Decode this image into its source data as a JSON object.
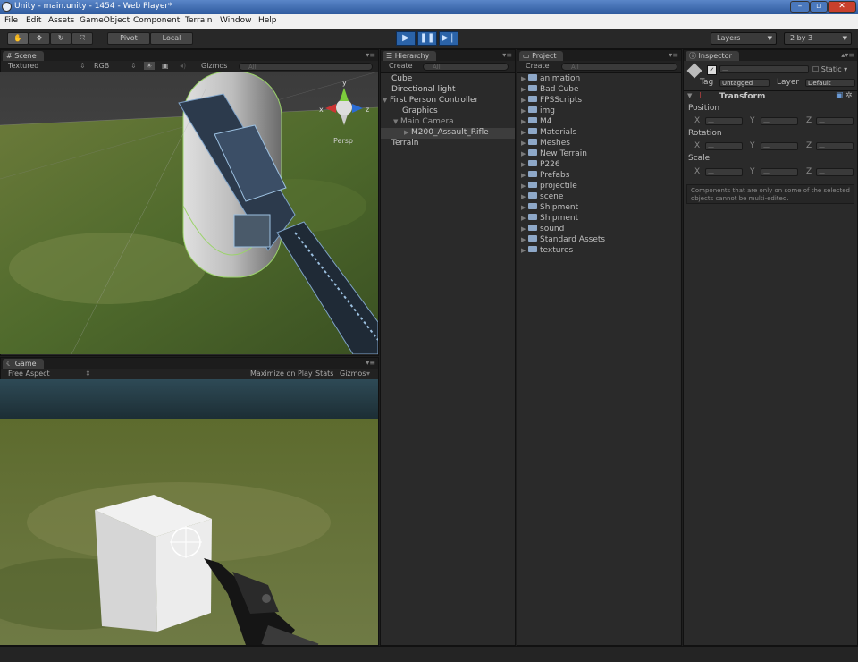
{
  "window": {
    "title": "Unity - main.unity - 1454 - Web Player*"
  },
  "menu": [
    "File",
    "Edit",
    "Assets",
    "GameObject",
    "Component",
    "Terrain",
    "Window",
    "Help"
  ],
  "toolbar": {
    "pivot": "Pivot",
    "local": "Local",
    "layers": "Layers",
    "layout": "2 by 3"
  },
  "scene": {
    "tab": "Scene",
    "render_mode": "Textured",
    "color_mode": "RGB",
    "gizmos": "Gizmos",
    "search": "All",
    "gizmo_label": "Persp",
    "axis_x": "x",
    "axis_y": "y",
    "axis_z": "z"
  },
  "game": {
    "tab": "Game",
    "aspect": "Free Aspect",
    "maximize": "Maximize on Play",
    "stats": "Stats",
    "gizmos": "Gizmos"
  },
  "hierarchy": {
    "tab": "Hierarchy",
    "create": "Create",
    "search": "All",
    "items": [
      {
        "label": "Cube"
      },
      {
        "label": "Directional light"
      },
      {
        "label": "First Person Controller"
      },
      {
        "label": "Graphics"
      },
      {
        "label": "Main Camera"
      },
      {
        "label": "M200_Assault_Rifle"
      },
      {
        "label": "Terrain"
      }
    ]
  },
  "project": {
    "tab": "Project",
    "create": "Create",
    "search": "All",
    "items": [
      {
        "label": "animation"
      },
      {
        "label": "Bad Cube"
      },
      {
        "label": "FPSScripts"
      },
      {
        "label": "img"
      },
      {
        "label": "M4"
      },
      {
        "label": "Materials"
      },
      {
        "label": "Meshes"
      },
      {
        "label": "New Terrain"
      },
      {
        "label": "P226"
      },
      {
        "label": "Prefabs"
      },
      {
        "label": "projectile"
      },
      {
        "label": "scene"
      },
      {
        "label": "Shipment"
      },
      {
        "label": "Shipment"
      },
      {
        "label": "sound"
      },
      {
        "label": "Standard Assets"
      },
      {
        "label": "textures"
      }
    ]
  },
  "inspector": {
    "tab": "Inspector",
    "static": "Static",
    "tag_label": "Tag",
    "tag_value": "Untagged",
    "layer_label": "Layer",
    "layer_value": "Default",
    "component": "Transform",
    "position": "Position",
    "rotation": "Rotation",
    "scale": "Scale",
    "x": "X",
    "y": "Y",
    "z": "Z",
    "dash": "—",
    "note": "Components that are only on some of the selected objects cannot be multi-edited."
  }
}
